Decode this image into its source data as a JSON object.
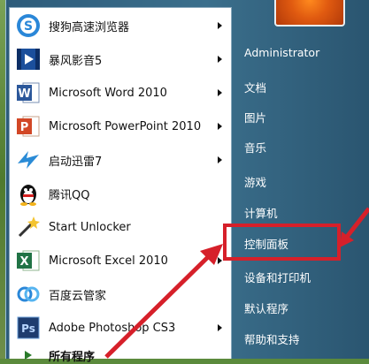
{
  "left_pane": {
    "items": [
      {
        "label": "搜狗高速浏览器",
        "icon": "sogou-browser-icon",
        "has_submenu": true
      },
      {
        "label": "暴风影音5",
        "icon": "baofeng-player-icon",
        "has_submenu": true
      },
      {
        "label": "Microsoft Word 2010",
        "icon": "word-icon",
        "has_submenu": true
      },
      {
        "label": "Microsoft PowerPoint 2010",
        "icon": "powerpoint-icon",
        "has_submenu": true
      },
      {
        "label": "启动迅雷7",
        "icon": "thunder-icon",
        "has_submenu": true
      },
      {
        "label": "腾讯QQ",
        "icon": "qq-penguin-icon",
        "has_submenu": false
      },
      {
        "label": "Start Unlocker",
        "icon": "unlocker-wand-icon",
        "has_submenu": false
      },
      {
        "label": "Microsoft Excel 2010",
        "icon": "excel-icon",
        "has_submenu": true
      },
      {
        "label": "百度云管家",
        "icon": "baidu-cloud-icon",
        "has_submenu": false
      },
      {
        "label": "Adobe Photoshop CS3",
        "icon": "photoshop-icon",
        "has_submenu": true
      },
      {
        "label": "所有程序",
        "icon": "all-programs-arrow-icon",
        "has_submenu": false
      }
    ]
  },
  "right_pane": {
    "items": [
      {
        "label": "Administrator"
      },
      {
        "label": "文档"
      },
      {
        "label": "图片"
      },
      {
        "label": "音乐"
      },
      {
        "label": "游戏"
      },
      {
        "label": "计算机"
      },
      {
        "label": "控制面板"
      },
      {
        "label": "设备和打印机"
      },
      {
        "label": "默认程序"
      },
      {
        "label": "帮助和支持"
      }
    ]
  },
  "colors": {
    "menu_blue": "#2d5b7a",
    "highlight_red": "#d6202a",
    "arrow_red": "#d6202a"
  }
}
